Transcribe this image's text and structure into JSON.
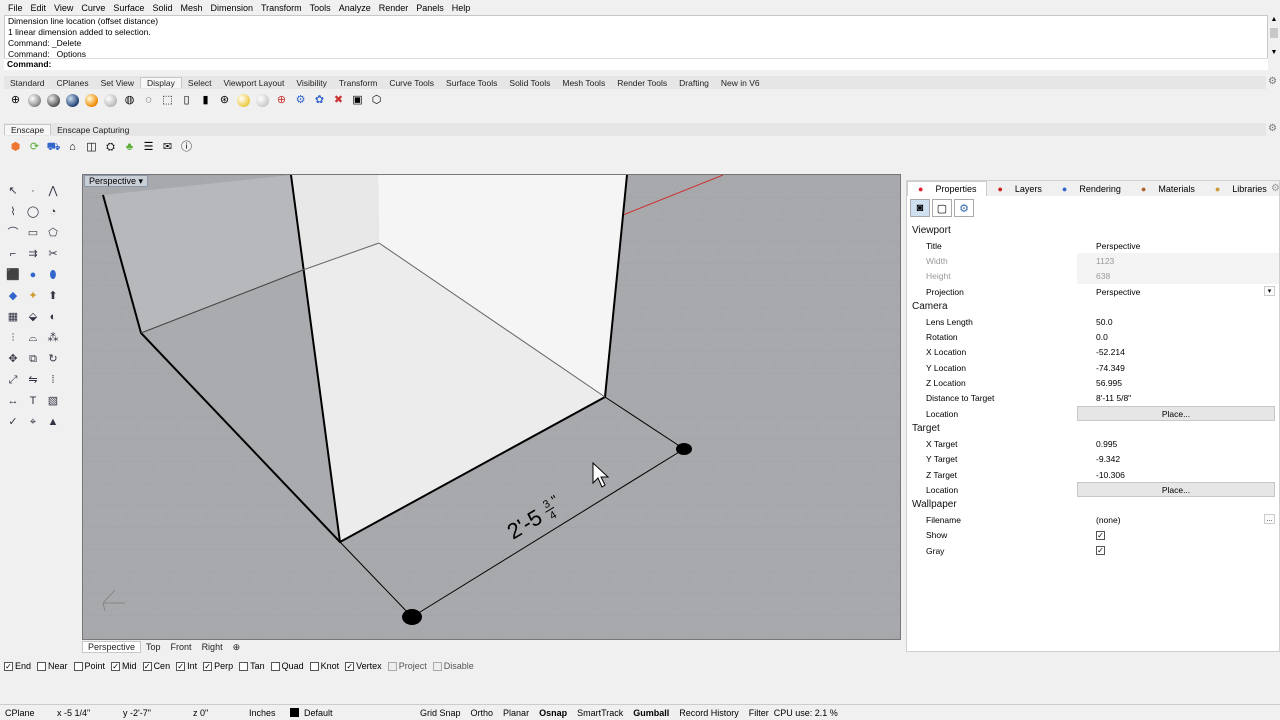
{
  "menu": [
    "File",
    "Edit",
    "View",
    "Curve",
    "Surface",
    "Solid",
    "Mesh",
    "Dimension",
    "Transform",
    "Tools",
    "Analyze",
    "Render",
    "Panels",
    "Help"
  ],
  "command_history": [
    "Dimension line location (offset distance)",
    "1 linear dimension added to selection.",
    "Command: _Delete",
    "Command: _Options"
  ],
  "command_prompt": "Command:",
  "toolbar_tabs": [
    "Standard",
    "CPlanes",
    "Set View",
    "Display",
    "Select",
    "Viewport Layout",
    "Visibility",
    "Transform",
    "Curve Tools",
    "Surface Tools",
    "Solid Tools",
    "Mesh Tools",
    "Render Tools",
    "Drafting",
    "New in V6"
  ],
  "toolbar_active": "Display",
  "plugin_tabs": [
    "Enscape",
    "Enscape Capturing"
  ],
  "viewport": {
    "label": "Perspective",
    "dimension_text": "2'-5",
    "dimension_frac_num": "3",
    "dimension_frac_den": "4",
    "dimension_inch": "\""
  },
  "viewport_tabs": [
    "Perspective",
    "Top",
    "Front",
    "Right"
  ],
  "osnap": [
    {
      "label": "End",
      "checked": true,
      "enabled": true
    },
    {
      "label": "Near",
      "checked": false,
      "enabled": true
    },
    {
      "label": "Point",
      "checked": false,
      "enabled": true
    },
    {
      "label": "Mid",
      "checked": true,
      "enabled": true
    },
    {
      "label": "Cen",
      "checked": true,
      "enabled": true
    },
    {
      "label": "Int",
      "checked": true,
      "enabled": true
    },
    {
      "label": "Perp",
      "checked": true,
      "enabled": true
    },
    {
      "label": "Tan",
      "checked": false,
      "enabled": true
    },
    {
      "label": "Quad",
      "checked": false,
      "enabled": true
    },
    {
      "label": "Knot",
      "checked": false,
      "enabled": true
    },
    {
      "label": "Vertex",
      "checked": true,
      "enabled": true
    },
    {
      "label": "Project",
      "checked": false,
      "enabled": false
    },
    {
      "label": "Disable",
      "checked": false,
      "enabled": false
    }
  ],
  "status": {
    "cplane": "CPlane",
    "x": "x -5 1/4\"",
    "y": "y -2'-7\"",
    "z": "z 0\"",
    "units": "Inches",
    "layer": "Default",
    "grid_snap": "Grid Snap",
    "ortho": "Ortho",
    "planar": "Planar",
    "osnap": "Osnap",
    "smarttrack": "SmartTrack",
    "gumball": "Gumball",
    "record_history": "Record History",
    "filter": "Filter",
    "cpu": "CPU use: 2.1 %"
  },
  "panel": {
    "tabs": [
      {
        "label": "Properties",
        "icon": "properties-icon",
        "color": "#d23"
      },
      {
        "label": "Layers",
        "icon": "layers-icon",
        "color": "#c22"
      },
      {
        "label": "Rendering",
        "icon": "rendering-icon",
        "color": "#36c"
      },
      {
        "label": "Materials",
        "icon": "materials-icon",
        "color": "#a63"
      },
      {
        "label": "Libraries",
        "icon": "libraries-icon",
        "color": "#c93"
      },
      {
        "label": "Help",
        "icon": "help-icon",
        "color": "#36a"
      }
    ],
    "sections": {
      "viewport": {
        "title": "Viewport",
        "title_label": "Title",
        "title_value": "Perspective",
        "width_label": "Width",
        "width_value": "1123",
        "height_label": "Height",
        "height_value": "638",
        "projection_label": "Projection",
        "projection_value": "Perspective"
      },
      "camera": {
        "title": "Camera",
        "lens_label": "Lens Length",
        "lens_value": "50.0",
        "rotation_label": "Rotation",
        "rotation_value": "0.0",
        "xloc_label": "X Location",
        "xloc_value": "-52.214",
        "yloc_label": "Y Location",
        "yloc_value": "-74.349",
        "zloc_label": "Z Location",
        "zloc_value": "56.995",
        "dist_label": "Distance to Target",
        "dist_value": "8'-11 5/8\"",
        "location_label": "Location",
        "location_button": "Place..."
      },
      "target": {
        "title": "Target",
        "x_label": "X Target",
        "x_value": "0.995",
        "y_label": "Y Target",
        "y_value": "-9.342",
        "z_label": "Z Target",
        "z_value": "-10.306",
        "location_label": "Location",
        "location_button": "Place..."
      },
      "wallpaper": {
        "title": "Wallpaper",
        "filename_label": "Filename",
        "filename_value": "(none)",
        "browse_button": "...",
        "show_label": "Show",
        "gray_label": "Gray"
      }
    }
  }
}
